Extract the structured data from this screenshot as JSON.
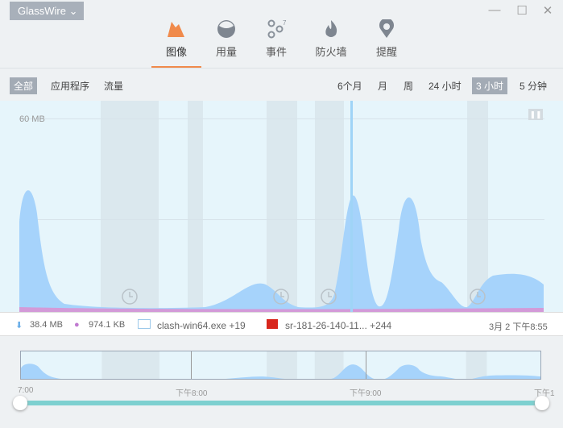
{
  "app": {
    "title": "GlassWire"
  },
  "nav": [
    {
      "label": "图像"
    },
    {
      "label": "用量"
    },
    {
      "label": "事件",
      "badge": "7"
    },
    {
      "label": "防火墙"
    },
    {
      "label": "提醒"
    }
  ],
  "filters": [
    "全部",
    "应用程序",
    "流量"
  ],
  "ranges": [
    "6个月",
    "月",
    "周",
    "24 小时",
    "3 小时",
    "5 分钟"
  ],
  "chart": {
    "scale_label": "60 MB"
  },
  "info": {
    "download": "38.4 MB",
    "upload": "974.1 KB",
    "app": "clash-win64.exe +19",
    "host": "sr-181-26-140-11... +244",
    "time": "3月 2 下午8:55"
  },
  "timeline": {
    "ticks": [
      "7:00",
      "下午8:00",
      "下午9:00",
      "下午1"
    ]
  },
  "colors": {
    "accent": "#f08a4b",
    "area": "#a6d3fb",
    "upload": "#d39ad8",
    "slider": "#7dd0d0"
  }
}
